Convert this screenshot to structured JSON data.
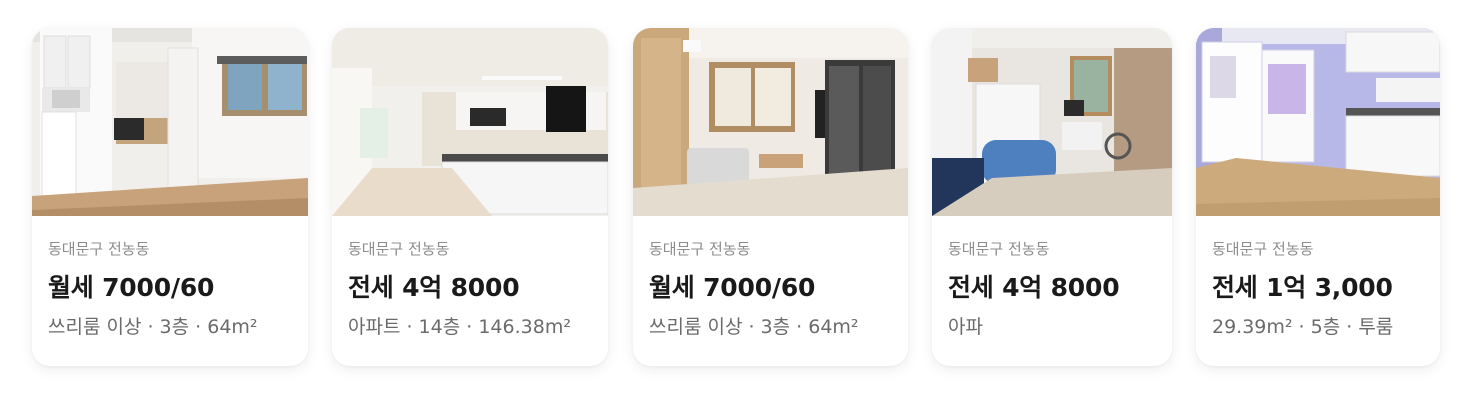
{
  "listings": [
    {
      "location": "동대문구 전농동",
      "price": "월세 7000/60",
      "detail": "쓰리룸 이상 · 3층 · 64m²"
    },
    {
      "location": "동대문구 전농동",
      "price": "전세 4억 8000",
      "detail": "아파트 · 14층 · 146.38m²"
    },
    {
      "location": "동대문구 전농동",
      "price": "월세 7000/60",
      "detail": "쓰리룸 이상 · 3층 · 64m²"
    },
    {
      "location": "동대문구 전농동",
      "price": "전세 4억 8000",
      "detail": "아파"
    },
    {
      "location": "동대문구 전농동",
      "price": "전세 1억 3,000",
      "detail": "29.39m² · 5층 · 투룸"
    }
  ]
}
